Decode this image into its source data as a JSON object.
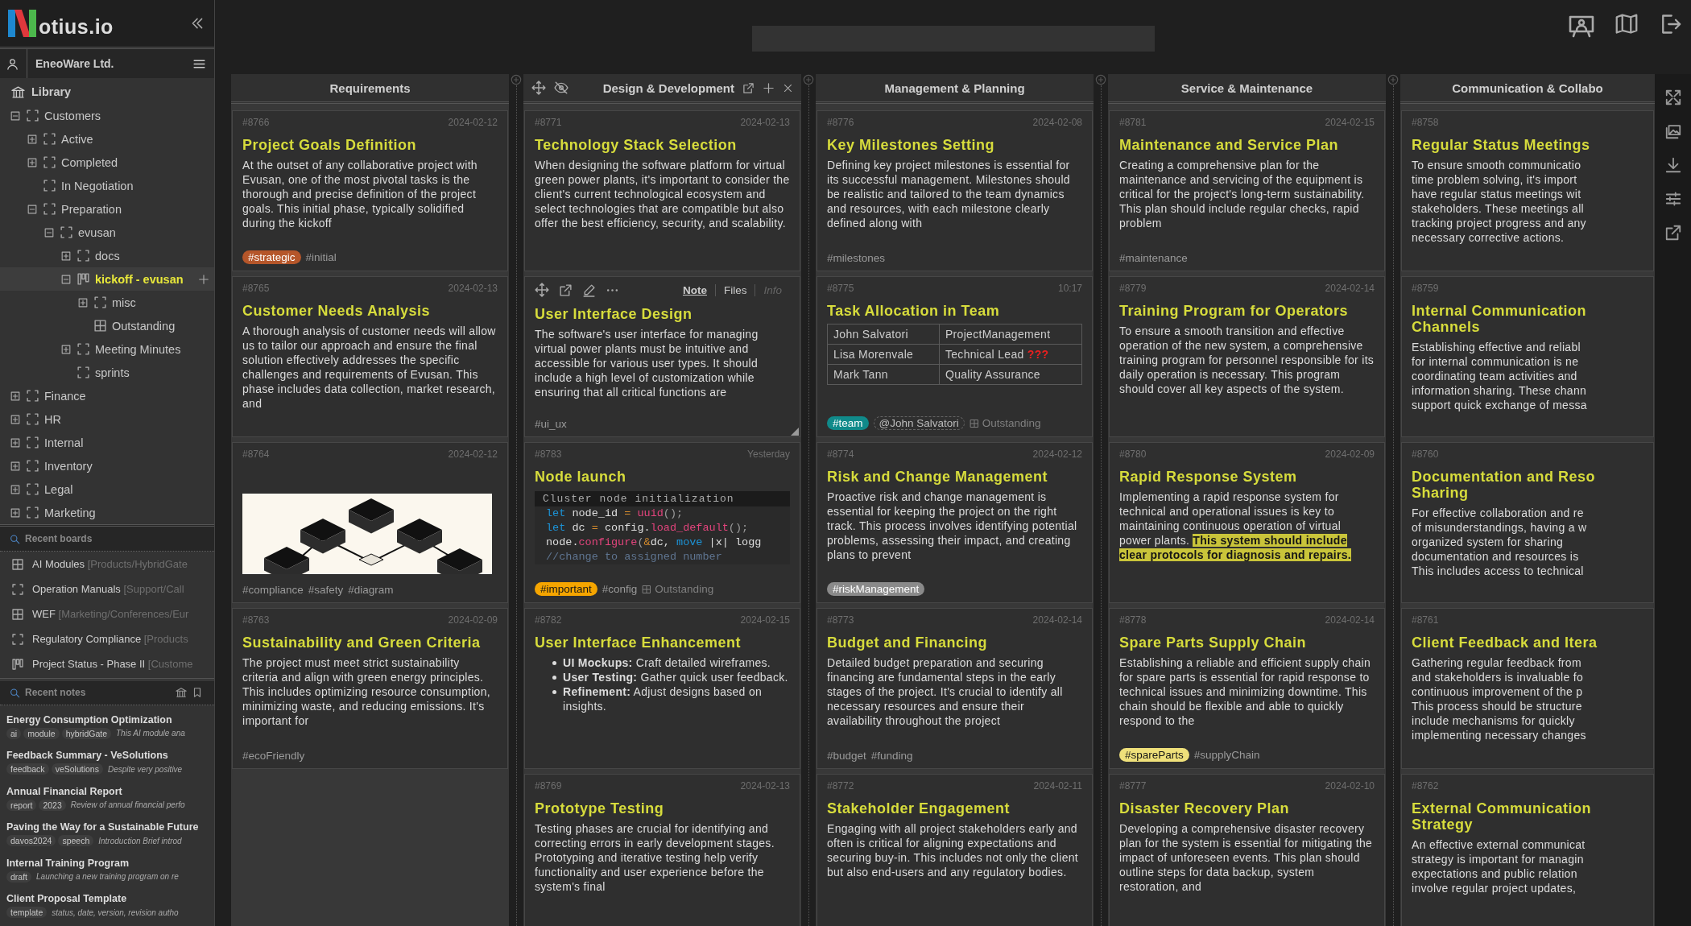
{
  "app": {
    "logo_text": "otius.io"
  },
  "sidebar": {
    "workspace": "EneoWare Ltd.",
    "library": "Library",
    "tree": [
      {
        "label": "Customers",
        "kind": "folder",
        "selected": false,
        "expanded": true,
        "children": [
          {
            "label": "Active",
            "kind": "folder",
            "selected": false,
            "expanded": false
          },
          {
            "label": "Completed",
            "kind": "folder",
            "selected": false,
            "expanded": false
          },
          {
            "label": "In Negotiation",
            "kind": "folder",
            "selected": false
          },
          {
            "label": "Preparation",
            "kind": "folder",
            "selected": false,
            "expanded": true,
            "children": [
              {
                "label": "evusan",
                "kind": "folder",
                "selected": false,
                "expanded": true,
                "children": [
                  {
                    "label": "docs",
                    "kind": "folder",
                    "selected": false,
                    "expanded": false
                  },
                  {
                    "label": "kickoff - evusan",
                    "kind": "board",
                    "selected": true,
                    "expanded": true,
                    "children": [
                      {
                        "label": "misc",
                        "kind": "folder",
                        "selected": false,
                        "expanded": false
                      },
                      {
                        "label": "Outstanding",
                        "kind": "grid",
                        "selected": false
                      }
                    ]
                  },
                  {
                    "label": "Meeting Minutes",
                    "kind": "folder",
                    "selected": false,
                    "expanded": false
                  },
                  {
                    "label": "sprints",
                    "kind": "folder",
                    "selected": false
                  }
                ]
              }
            ]
          }
        ]
      },
      {
        "label": "Finance",
        "kind": "folder",
        "selected": false,
        "expanded": false
      },
      {
        "label": "HR",
        "kind": "folder",
        "selected": false,
        "expanded": false
      },
      {
        "label": "Internal",
        "kind": "folder",
        "selected": false,
        "expanded": false
      },
      {
        "label": "Inventory",
        "kind": "folder",
        "selected": false,
        "expanded": false
      },
      {
        "label": "Legal",
        "kind": "folder",
        "selected": false,
        "expanded": false
      },
      {
        "label": "Marketing",
        "kind": "folder",
        "selected": false,
        "expanded": false
      }
    ],
    "recent_boards": {
      "title": "Recent boards",
      "items": [
        {
          "name": "AI Modules",
          "path": "[Products/HybridGate",
          "kind": "grid"
        },
        {
          "name": "Operation Manuals",
          "path": "[Support/Call",
          "kind": "folder"
        },
        {
          "name": "WEF",
          "path": "[Marketing/Conferences/Eur",
          "kind": "grid"
        },
        {
          "name": "Regulatory Compliance",
          "path": "[Products",
          "kind": "folder"
        },
        {
          "name": "Project Status - Phase II",
          "path": "[Custome",
          "kind": "board"
        }
      ]
    },
    "recent_notes": {
      "title": "Recent notes",
      "items": [
        {
          "title": "Energy Consumption Optimization",
          "tags": [
            "ai",
            "module",
            "hybridGate"
          ],
          "excerpt": "This AI module ana"
        },
        {
          "title": "Feedback Summary - VeSolutions",
          "tags": [
            "feedback",
            "veSolutions"
          ],
          "excerpt": "Despite very positive"
        },
        {
          "title": "Annual Financial Report",
          "tags": [
            "report",
            "2023"
          ],
          "excerpt": "Review of annual financial perfo"
        },
        {
          "title": "Paving the Way for a Sustainable Future",
          "tags": [
            "davos2024",
            "speech"
          ],
          "excerpt": "Introduction Brief introd"
        },
        {
          "title": "Internal Training Program",
          "tags": [
            "draft"
          ],
          "excerpt": "Launching a new training program on re"
        },
        {
          "title": "Client Proposal Template",
          "tags": [
            "template"
          ],
          "excerpt": "status, date, version, revision autho"
        }
      ]
    }
  },
  "columns": [
    {
      "title": "Requirements",
      "hovered": false,
      "cards": [
        {
          "id": "#8766",
          "date": "2024-02-12",
          "hovered": false,
          "kind": "text",
          "title": "Project Goals Definition",
          "body": "At the outset of any collaborative project with Evusan, one of the most pivotal tasks is the thorough and precise definition of the project goals. This initial phase, typically solidified during the kickoff",
          "tags": [
            {
              "kind": "pill",
              "text": "#strategic",
              "color": "#b5562a"
            },
            {
              "kind": "plain",
              "text": "#initial"
            }
          ]
        },
        {
          "id": "#8765",
          "date": "2024-02-13",
          "hovered": false,
          "kind": "text",
          "title": "Customer Needs Analysis",
          "body": "A thorough analysis of customer needs will allow us to tailor our approach and ensure the final solution effectively addresses the specific challenges and requirements of Evusan. This phase includes data collection, market research, and"
        },
        {
          "id": "#8764",
          "date": "2024-02-12",
          "hovered": false,
          "kind": "picture",
          "tags": [
            {
              "kind": "plain",
              "text": "#compliance"
            },
            {
              "kind": "plain",
              "text": "#safety"
            },
            {
              "kind": "plain",
              "text": "#diagram"
            }
          ]
        },
        {
          "id": "#8763",
          "date": "2024-02-09",
          "hovered": false,
          "kind": "text",
          "title": "Sustainability and Green Criteria",
          "body": "The project must meet strict sustainability criteria and align with green energy principles. This includes optimizing resource consumption, minimizing waste, and reducing emissions. It's important for",
          "tags": [
            {
              "kind": "plain",
              "text": "#ecoFriendly"
            }
          ]
        }
      ]
    },
    {
      "title": "Design & Development",
      "hovered": true,
      "cards": [
        {
          "id": "#8771",
          "date": "2024-02-13",
          "hovered": false,
          "kind": "text",
          "title": "Technology Stack Selection",
          "body": "When designing the software platform for virtual green power plants, it's important to consider the client's current technological ecosystem and select technologies that are compatible but also offer the best efficiency, security, and scalability."
        },
        {
          "hovered": true,
          "tabs": [
            {
              "label": "Note",
              "selected": true,
              "disabled": false
            },
            {
              "label": "Files",
              "selected": false,
              "disabled": false
            },
            {
              "label": "Info",
              "selected": false,
              "disabled": true
            }
          ],
          "kind": "text",
          "title": "User Interface Design",
          "body": "The software's user interface for managing virtual power plants must be intuitive and accessible for various user types. It should include a high level of customization while ensuring that all critical functions are",
          "tags": [
            {
              "kind": "plain",
              "text": "#ui_ux"
            }
          ]
        },
        {
          "id": "#8783",
          "date": "Yesterday",
          "hovered": false,
          "kind": "code",
          "title": "Node launch",
          "code": {
            "caption": "Cluster node initialization",
            "lines": [
              [
                {
                  "text": "let",
                  "kind": "keyword"
                },
                {
                  "text": " node_id ",
                  "kind": "plain"
                },
                {
                  "text": "=",
                  "kind": "operator"
                },
                {
                  "text": " uuid",
                  "kind": "function"
                },
                {
                  "text": "();",
                  "kind": "punct"
                }
              ],
              [
                {
                  "text": "let",
                  "kind": "keyword"
                },
                {
                  "text": " dc ",
                  "kind": "plain"
                },
                {
                  "text": "=",
                  "kind": "operator"
                },
                {
                  "text": " config.",
                  "kind": "plain"
                },
                {
                  "text": "load_default",
                  "kind": "function"
                },
                {
                  "text": "();",
                  "kind": "punct"
                }
              ],
              [
                {
                  "text": "node.",
                  "kind": "plain"
                },
                {
                  "text": "configure",
                  "kind": "function"
                },
                {
                  "text": "(",
                  "kind": "punct"
                },
                {
                  "text": "&",
                  "kind": "operator"
                },
                {
                  "text": "dc, ",
                  "kind": "plain"
                },
                {
                  "text": "move",
                  "kind": "keyword"
                },
                {
                  "text": " |x| logg",
                  "kind": "plain"
                }
              ],
              [
                {
                  "text": "//change to assigned number",
                  "kind": "comment"
                }
              ]
            ]
          },
          "tags": [
            {
              "kind": "pill",
              "text": "#important",
              "color": "#f5a500"
            },
            {
              "kind": "plain",
              "text": "#config"
            },
            {
              "kind": "board",
              "text": "Outstanding"
            }
          ]
        },
        {
          "id": "#8782",
          "date": "2024-02-15",
          "hovered": false,
          "kind": "list",
          "title": "User Interface Enhancement",
          "items": [
            "**UI Mockups:** Craft detailed wireframes.",
            "**User Testing:** Gather quick user feedback.",
            "**Refinement:** Adjust designs based on insights."
          ]
        },
        {
          "id": "#8769",
          "date": "2024-02-13",
          "hovered": false,
          "kind": "text",
          "title": "Prototype Testing",
          "body": "Testing phases are crucial for identifying and correcting errors in early development stages. Prototyping and iterative testing help verify functionality and user experience before the system's final"
        }
      ]
    },
    {
      "title": "Management & Planning",
      "hovered": false,
      "cards": [
        {
          "id": "#8776",
          "date": "2024-02-08",
          "hovered": false,
          "kind": "text",
          "title": "Key Milestones Setting",
          "body": "Defining key project milestones is essential for its successful management. Milestones should be realistic and tailored to the team dynamics and resources, with each milestone clearly defined along with",
          "tags": [
            {
              "kind": "plain",
              "text": "#milestones"
            }
          ]
        },
        {
          "id": "#8775",
          "date": "10:17",
          "hovered": false,
          "kind": "table",
          "title": "Task Allocation in Team",
          "rows": [
            [
              {
                "text": "John Salvatori"
              },
              {
                "text": "ProjectManagement"
              }
            ],
            [
              {
                "text": "Lisa Morenvale"
              },
              {
                "text": "Technical Lead",
                "alert": "???"
              }
            ],
            [
              {
                "text": "Mark Tann"
              },
              {
                "text": "Quality Assurance"
              }
            ]
          ],
          "tags": [
            {
              "kind": "pill",
              "text": "#team",
              "color": "#108a8a"
            },
            {
              "kind": "mention",
              "text": "@John Salvatori"
            },
            {
              "kind": "board",
              "text": "Outstanding"
            }
          ]
        },
        {
          "id": "#8774",
          "date": "2024-02-12",
          "hovered": false,
          "kind": "text",
          "title": "Risk and Change Management",
          "body": "Proactive risk and change management is essential for keeping the project on the right track. This process involves identifying potential problems, assessing their impact, and creating plans to prevent",
          "tags": [
            {
              "kind": "pill",
              "text": "#riskManagement",
              "color": "#8a8a8a"
            }
          ]
        },
        {
          "id": "#8773",
          "date": "2024-02-14",
          "hovered": false,
          "kind": "text",
          "title": "Budget and Financing",
          "body": "Detailed budget preparation and securing financing are fundamental steps in the early stages of the project. It's crucial to identify all necessary resources and ensure their availability throughout the project",
          "tags": [
            {
              "kind": "plain",
              "text": "#budget"
            },
            {
              "kind": "plain",
              "text": "#funding"
            }
          ]
        },
        {
          "id": "#8772",
          "date": "2024-02-11",
          "hovered": false,
          "kind": "text",
          "title": "Stakeholder Engagement",
          "body": "Engaging with all project stakeholders early and often is critical for aligning expectations and securing buy-in. This includes not only the client but also end-users and any regulatory bodies."
        }
      ]
    },
    {
      "title": "Service & Maintenance",
      "hovered": false,
      "cards": [
        {
          "id": "#8781",
          "date": "2024-02-15",
          "hovered": false,
          "kind": "text",
          "title": "Maintenance and Service Plan",
          "body": "Creating a comprehensive plan for the maintenance and servicing of the equipment is critical for the project's long-term sustainability. This plan should include regular checks, rapid problem",
          "tags": [
            {
              "kind": "plain",
              "text": "#maintenance"
            }
          ]
        },
        {
          "id": "#8779",
          "date": "2024-02-14",
          "hovered": false,
          "kind": "text",
          "title": "Training Program for Operators",
          "body": "To ensure a smooth transition and effective operation of the new system, a comprehensive training program for personnel responsible for its daily operation is necessary. This program should cover all key aspects of the system."
        },
        {
          "id": "#8780",
          "date": "2024-02-09",
          "hovered": false,
          "kind": "text",
          "title": "Rapid Response System",
          "body": "Implementing a rapid response system for technical and operational issues is key to maintaining continuous operation of virtual power plants. **This system should include clear protocols for diagnosis and repairs.**"
        },
        {
          "id": "#8778",
          "date": "2024-02-14",
          "hovered": false,
          "kind": "text",
          "title": "Spare Parts Supply Chain",
          "body": "Establishing a reliable and efficient supply chain for spare parts is essential for rapid response to technical issues and minimizing downtime. This chain should be flexible and able to quickly respond to the",
          "tags": [
            {
              "kind": "pill",
              "text": "#spareParts",
              "color": "#efe07a"
            },
            {
              "kind": "plain",
              "text": "#supplyChain"
            }
          ]
        },
        {
          "id": "#8777",
          "date": "2024-02-10",
          "hovered": false,
          "kind": "text",
          "title": "Disaster Recovery Plan",
          "body": "Developing a comprehensive disaster recovery plan for the system is essential for mitigating the impact of unforeseen events. This plan should outline steps for data backup, system restoration, and"
        }
      ]
    },
    {
      "title": "Communication & Collabo",
      "hovered": false,
      "cards": [
        {
          "id": "#8758",
          "hovered": false,
          "kind": "text",
          "title": "Regular Status Meetings",
          "body": "To ensure smooth communicatio\ntime problem solving, it's import\nhave regular status meetings wit\nstakeholders. These meetings all\ntracking project progress and any\nnecessary corrective actions."
        },
        {
          "id": "#8759",
          "hovered": false,
          "kind": "text",
          "title": "Internal Communication\nChannels",
          "body": "Establishing effective and reliabl\nfor internal communication is ne\ncoordinating team activities and\ninformation sharing. These chann\nsupport quick exchange of messa"
        },
        {
          "id": "#8760",
          "hovered": false,
          "kind": "text",
          "title": "Documentation and Reso\nSharing",
          "body": "For effective collaboration and re\nof misunderstandings, having a w\norganized system for sharing\ndocumentation and resources is\nThis includes access to technical"
        },
        {
          "id": "#8761",
          "hovered": false,
          "kind": "text",
          "title": "Client Feedback and Itera",
          "body": "Gathering regular feedback from\nand stakeholders is invaluable fo\ncontinuous improvement of the p\nThis process should be structure\ninclude mechanisms for quickly\nimplementing necessary changes"
        },
        {
          "id": "#8762",
          "hovered": false,
          "kind": "text",
          "title": "External Communication\nStrategy",
          "body": "An effective external communicat\nstrategy is important for managin\nexpectations and public relation\ninvolve regular project updates,"
        }
      ]
    }
  ]
}
